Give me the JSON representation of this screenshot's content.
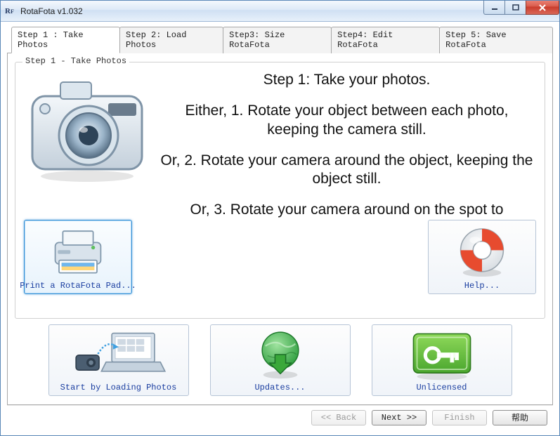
{
  "window": {
    "title": "RotaFota v1.032"
  },
  "tabs": [
    {
      "label": "Step 1 : Take Photos",
      "active": true
    },
    {
      "label": "Step 2: Load Photos"
    },
    {
      "label": "Step3: Size RotaFota"
    },
    {
      "label": "Step4: Edit RotaFota"
    },
    {
      "label": "Step 5: Save RotaFota"
    }
  ],
  "group": {
    "legend": "Step 1 - Take Photos"
  },
  "instructions": {
    "title": "Step 1: Take your photos.",
    "line1": "Either, 1. Rotate your object between each photo, keeping the camera still.",
    "line2": "Or, 2. Rotate your camera around the object, keeping the object still.",
    "line3": "Or, 3. Rotate your camera around on the spot to"
  },
  "tiles": {
    "print": "Print a RotaFota Pad...",
    "help": "Help...",
    "load": "Start by Loading Photos",
    "updates": "Updates...",
    "unlicensed": "Unlicensed"
  },
  "wizard": {
    "back": "<< Back",
    "next": "Next >>",
    "finish": "Finish",
    "help": "帮助"
  }
}
